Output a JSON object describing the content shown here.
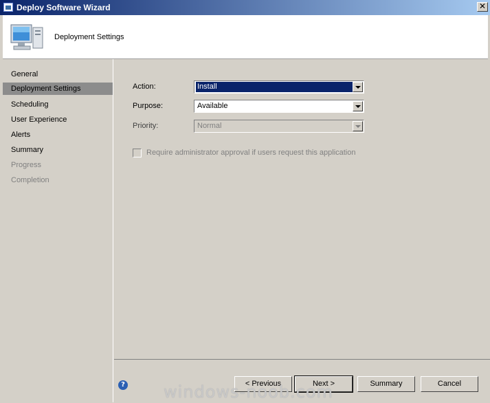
{
  "window": {
    "title": "Deploy Software Wizard",
    "close_glyph": "✕"
  },
  "header": {
    "title": "Deployment Settings",
    "icon": "computer-icon"
  },
  "nav": {
    "items": [
      {
        "label": "General",
        "state": "normal"
      },
      {
        "label": "Deployment Settings",
        "state": "active"
      },
      {
        "label": "Scheduling",
        "state": "normal"
      },
      {
        "label": "User Experience",
        "state": "normal"
      },
      {
        "label": "Alerts",
        "state": "normal"
      },
      {
        "label": "Summary",
        "state": "normal"
      },
      {
        "label": "Progress",
        "state": "disabled"
      },
      {
        "label": "Completion",
        "state": "disabled"
      }
    ]
  },
  "form": {
    "action": {
      "label": "Action:",
      "value": "Install"
    },
    "purpose": {
      "label": "Purpose:",
      "value": "Available"
    },
    "priority": {
      "label": "Priority:",
      "value": "Normal"
    },
    "approval": {
      "label": "Require administrator approval if users request this application",
      "checked": false
    }
  },
  "buttons": {
    "previous": "< Previous",
    "next": "Next >",
    "summary": "Summary",
    "cancel": "Cancel",
    "help": "?"
  },
  "watermark": "windows-noob.com"
}
